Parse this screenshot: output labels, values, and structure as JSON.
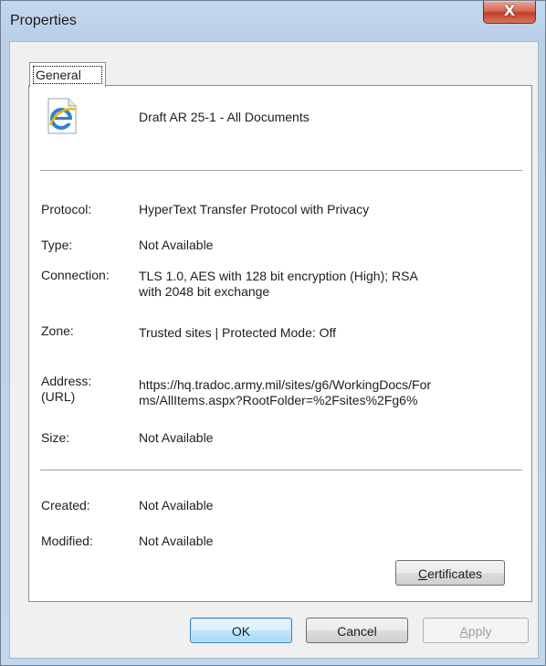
{
  "window": {
    "title": "Properties",
    "close_symbol": "X"
  },
  "tabs": [
    {
      "label": "General"
    }
  ],
  "document": {
    "icon": "internet-explorer-document-icon",
    "title": "Draft AR 25-1 - All Documents"
  },
  "properties": {
    "protocol": {
      "label": "Protocol:",
      "value": "HyperText Transfer Protocol with Privacy"
    },
    "type": {
      "label": "Type:",
      "value": "Not Available"
    },
    "connection": {
      "label": "Connection:",
      "value_line1": "TLS 1.0, AES with 128 bit encryption (High); RSA",
      "value_line2": "with 2048 bit exchange"
    },
    "zone": {
      "label": "Zone:",
      "value": "Trusted sites | Protected Mode: Off"
    },
    "address": {
      "label_line1": "Address:",
      "label_line2": "(URL)",
      "value_line1": "https://hq.tradoc.army.mil/sites/g6/WorkingDocs/For",
      "value_line2": "ms/AllItems.aspx?RootFolder=%2Fsites%2Fg6%"
    },
    "size": {
      "label": "Size:",
      "value": "Not Available"
    },
    "created": {
      "label": "Created:",
      "value": "Not Available"
    },
    "modified": {
      "label": "Modified:",
      "value": "Not Available"
    }
  },
  "buttons": {
    "certificates": {
      "mnemonic": "C",
      "rest": "ertificates"
    },
    "ok": "OK",
    "cancel": "Cancel",
    "apply": {
      "mnemonic": "A",
      "rest": "pply"
    }
  },
  "colors": {
    "frame": "#c2d7ee",
    "close": "#c0402a",
    "panel": "#ffffff",
    "client": "#f0f0f0",
    "default_button": "#3c7fb1"
  }
}
